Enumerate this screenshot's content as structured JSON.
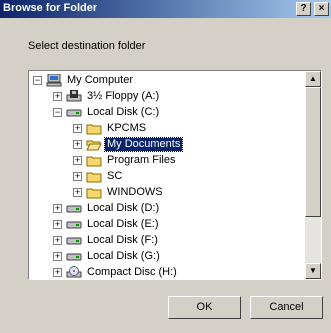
{
  "window": {
    "title": "Browse for Folder",
    "help_label": "?",
    "close_label": "×"
  },
  "prompt": "Select destination folder",
  "tree": {
    "items": [
      {
        "label": "My Computer",
        "icon": "computer-icon",
        "expander": "−"
      },
      {
        "label": "3½ Floppy (A:)",
        "icon": "floppy-drive-icon",
        "expander": "+"
      },
      {
        "label": "Local Disk (C:)",
        "icon": "hard-drive-icon",
        "expander": "−"
      },
      {
        "label": "KPCMS",
        "icon": "folder-icon",
        "expander": "+"
      },
      {
        "label": "My Documents",
        "icon": "open-folder-icon",
        "expander": "+",
        "selected": true
      },
      {
        "label": "Program Files",
        "icon": "folder-icon",
        "expander": "+"
      },
      {
        "label": "SC",
        "icon": "folder-icon",
        "expander": "+"
      },
      {
        "label": "WINDOWS",
        "icon": "folder-icon",
        "expander": "+"
      },
      {
        "label": "Local Disk (D:)",
        "icon": "hard-drive-icon",
        "expander": "+"
      },
      {
        "label": "Local Disk (E:)",
        "icon": "hard-drive-icon",
        "expander": "+"
      },
      {
        "label": "Local Disk (F:)",
        "icon": "hard-drive-icon",
        "expander": "+"
      },
      {
        "label": "Local Disk (G:)",
        "icon": "hard-drive-icon",
        "expander": "+"
      },
      {
        "label": "Compact Disc (H:)",
        "icon": "cd-drive-icon",
        "expander": "+"
      }
    ]
  },
  "scroll": {
    "up_label": "▲",
    "down_label": "▼"
  },
  "buttons": {
    "ok_label": "OK",
    "cancel_label": "Cancel"
  },
  "colors": {
    "title_start": "#0a246a",
    "title_end": "#a6caf0",
    "selection": "#0a246a",
    "face": "#d4d0c8"
  }
}
